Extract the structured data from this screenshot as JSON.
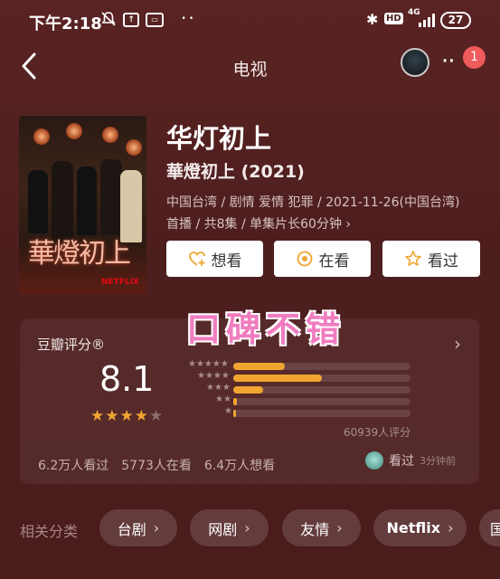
{
  "status": {
    "time": "下午2:18",
    "battery": "27",
    "hd": "HD",
    "network": "4G"
  },
  "nav": {
    "title": "电视",
    "badge": "1"
  },
  "movie": {
    "title": "华灯初上",
    "original_title": "華燈初上 (2021)",
    "meta_line1": "中国台湾 / 剧情 爱情 犯罪 / 2021-11-26(中国台湾)",
    "meta_line2": "首播 / 共8集 / 单集片长60分钟 ›",
    "poster_text": "華燈初上",
    "poster_brand": "NETFLIX"
  },
  "actions": [
    {
      "label": "想看",
      "icon": "heart-plus-icon"
    },
    {
      "label": "在看",
      "icon": "target-icon"
    },
    {
      "label": "看过",
      "icon": "star-outline-icon"
    }
  ],
  "sticker": "口碑不错",
  "rating": {
    "title": "豆瓣评分®",
    "score": "8.1",
    "stars": 4,
    "distribution": [
      {
        "stars": 5,
        "fraction": 0.29
      },
      {
        "stars": 4,
        "fraction": 0.5
      },
      {
        "stars": 3,
        "fraction": 0.17
      },
      {
        "stars": 2,
        "fraction": 0.02
      },
      {
        "stars": 1,
        "fraction": 0.01
      }
    ],
    "count": "60939人评分",
    "watched": "6.2万人看过",
    "watching": "5773人在看",
    "want": "6.4万人想看",
    "user_status": "看过",
    "user_time": "3分钟前",
    "colors": {
      "accent": "#f0a531",
      "star_empty": "#8a6d6d"
    }
  },
  "related": {
    "label": "相关分类",
    "chips": [
      "台剧",
      "网剧",
      "友情",
      "Netflix",
      "国"
    ]
  }
}
